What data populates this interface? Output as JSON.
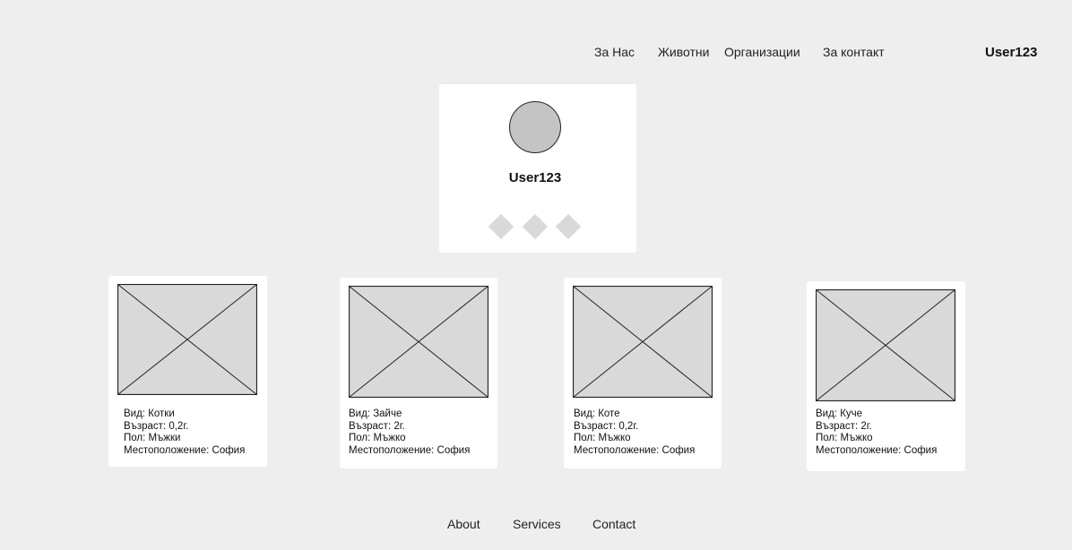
{
  "nav": {
    "items": [
      {
        "label": "За  Нас"
      },
      {
        "label": "Животни"
      },
      {
        "label": "Организации"
      },
      {
        "label": "За контакт"
      }
    ],
    "user": "User123"
  },
  "profile": {
    "name": "User123",
    "actions": 3
  },
  "animals": [
    {
      "species": "Вид: Котки",
      "age": "Възраст: 0,2г.",
      "sex": "Пол: Мъжки",
      "location": "Местоположение: София"
    },
    {
      "species": "Вид: Зайче",
      "age": "Възраст: 2г.",
      "sex": "Пол: Мъжко",
      "location": "Местоположение: София"
    },
    {
      "species": "Вид: Коте",
      "age": "Възраст: 0,2г.",
      "sex": "Пол: Мъжко",
      "location": "Местоположение: София"
    },
    {
      "species": "Вид: Куче",
      "age": "Възраст: 2г.",
      "sex": "Пол: Мъжко",
      "location": "Местоположение: София"
    }
  ],
  "footer": {
    "links": [
      {
        "label": "About"
      },
      {
        "label": "Services"
      },
      {
        "label": "Contact"
      }
    ]
  },
  "colors": {
    "background": "#eeeeee",
    "card": "#ffffff",
    "placeholder": "#d9d9d9",
    "avatar": "#c4c4c4"
  }
}
